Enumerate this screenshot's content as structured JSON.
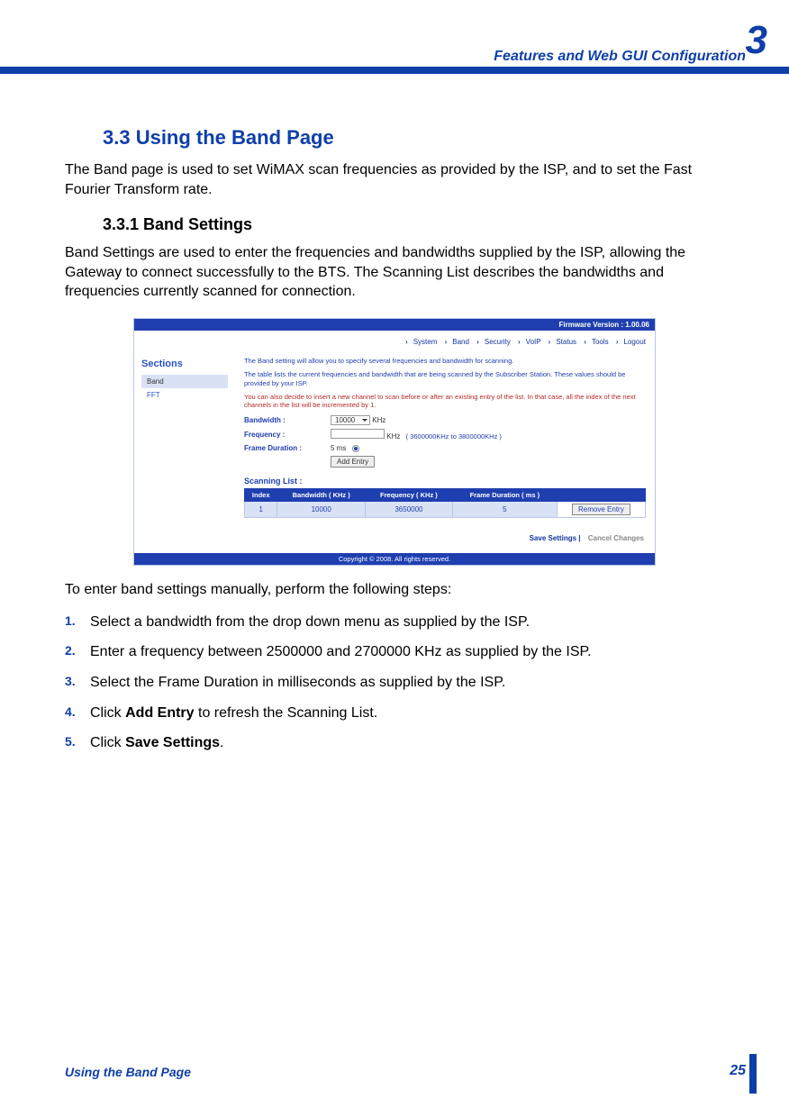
{
  "header": {
    "chapter_number": "3",
    "chapter_title": "Features and Web GUI Configuration"
  },
  "section_3_3": {
    "heading": "3.3 Using the Band Page",
    "para": "The Band page is used to set WiMAX scan frequencies as provided by the ISP, and to set the Fast Fourier Transform rate."
  },
  "section_3_3_1": {
    "heading": "3.3.1 Band Settings",
    "para": "Band Settings are used to enter the frequencies and bandwidths supplied by the ISP, allowing the Gateway to connect successfully to the BTS. The Scanning List describes the bandwidths and frequencies currently scanned for connection."
  },
  "screenshot": {
    "firmware": "Firmware Version : 1.00.06",
    "nav": [
      "System",
      "Band",
      "Security",
      "VoIP",
      "Status",
      "Tools",
      "Logout"
    ],
    "sidebar_title": "Sections",
    "sidebar_items": [
      "Band",
      "FFT"
    ],
    "intro1": "The Band setting will allow you to specify several frequencies and bandwidth for scanning.",
    "intro2": "The table lists the current frequencies and bandwidth that are being scanned by the Subscriber Station. These values should be provided by your ISP.",
    "intro3": "You can also decide to insert a new channel to scan before or after an existing entry of the list. In that case, all the index of the next channels in the list will be incremented by 1.",
    "fields": {
      "bandwidth_label": "Bandwidth :",
      "bandwidth_value": "10000",
      "bandwidth_unit": "KHz",
      "frequency_label": "Frequency :",
      "frequency_unit": "KHz",
      "frequency_range": "( 3600000KHz to 3800000KHz )",
      "frame_label": "Frame Duration :",
      "frame_value": "5 ms",
      "add_entry_btn": "Add Entry"
    },
    "scanning_list_title": "Scanning List :",
    "table_headers": [
      "Index",
      "Bandwidth ( KHz )",
      "Frequency ( KHz )",
      "Frame Duration ( ms )",
      ""
    ],
    "table_row": {
      "index": "1",
      "bw": "10000",
      "freq": "3650000",
      "fd": "5",
      "remove": "Remove Entry"
    },
    "save_settings": "Save Settings",
    "cancel_changes": "Cancel Changes",
    "footer": "Copyright © 2008. All rights reserved."
  },
  "steps_intro": "To enter band settings manually, perform the following steps:",
  "steps": [
    {
      "n": "1.",
      "t1": "Select a bandwidth from the drop down menu as supplied by the ISP."
    },
    {
      "n": "2.",
      "t1": "Enter a frequency between 2500000 and 2700000 KHz as supplied by the ISP."
    },
    {
      "n": "3.",
      "t1": "Select the Frame Duration in milliseconds as supplied by the ISP."
    },
    {
      "n": "4.",
      "t1": "Click ",
      "b": "Add Entry",
      "t2": " to refresh the Scanning List."
    },
    {
      "n": "5.",
      "t1": "Click ",
      "b": "Save Settings",
      "t2": "."
    }
  ],
  "footer": {
    "left": "Using the Band Page",
    "right": "25"
  }
}
